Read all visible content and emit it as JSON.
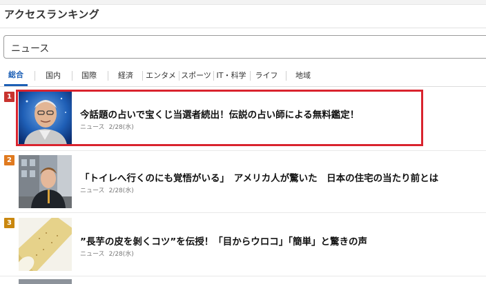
{
  "header": {
    "title": "アクセスランキング"
  },
  "filter": {
    "selected": "ニュース"
  },
  "tabs": [
    {
      "label": "総合",
      "active": true
    },
    {
      "label": "国内"
    },
    {
      "label": "国際"
    },
    {
      "label": "経済"
    },
    {
      "label": "エンタメ"
    },
    {
      "label": "スポーツ"
    },
    {
      "label": "IT・科学"
    },
    {
      "label": "ライフ"
    },
    {
      "label": "地域"
    }
  ],
  "articles": [
    {
      "rank": "1",
      "title": "今話題の占いで宝くじ当選者続出！伝説の占い師による無料鑑定！",
      "source": "ニュース",
      "date": "2/28(水)",
      "rank_color": "#c8332e"
    },
    {
      "rank": "2",
      "title": "「トイレへ行くのにも覚悟がいる」　アメリカ人が驚いた　日本の住宅の当たり前とは",
      "source": "ニュース",
      "date": "2/28(水)",
      "rank_color": "#e07a1f"
    },
    {
      "rank": "3",
      "title": "”長芋の皮を剝くコツ”を伝授！「目からウロコ」「簡単」と驚きの声",
      "source": "ニュース",
      "date": "2/28(水)",
      "rank_color": "#c9870f"
    }
  ],
  "colors": {
    "accent": "#1c5fb5",
    "highlight_border": "#d9232e"
  }
}
